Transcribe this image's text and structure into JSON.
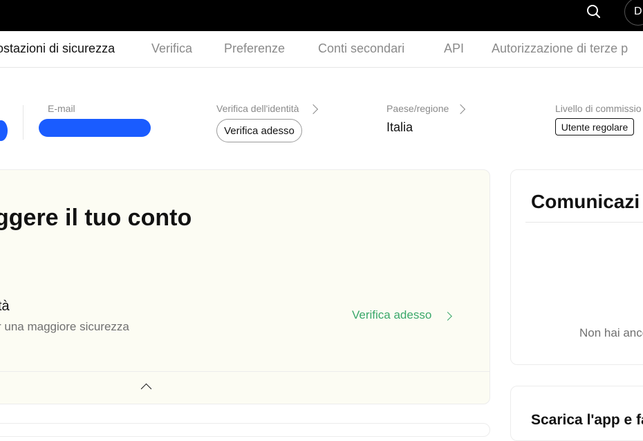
{
  "header": {
    "search_icon": "search-icon",
    "avatar_initial": "D"
  },
  "tabs": [
    {
      "label": "Impostazioni di sicurezza",
      "visible_label": "ostazioni di sicurezza",
      "active": true
    },
    {
      "label": "Verifica",
      "active": false
    },
    {
      "label": "Preferenze",
      "active": false
    },
    {
      "label": "Conti secondari",
      "active": false
    },
    {
      "label": "API",
      "active": false
    },
    {
      "label": "Autorizzazione di terze p",
      "active": false
    }
  ],
  "profile": {
    "email_label": "E-mail",
    "identity_label": "Verifica dell'identità",
    "identity_button": "Verifica adesso",
    "country_label": "Paese/regione",
    "country_value": "Italia",
    "fee_label": "Livello di commissio",
    "fee_badge": "Utente regolare"
  },
  "security_card": {
    "title": "ggere il tuo conto",
    "item_title": "tà",
    "item_subtitle": "r una maggiore sicurezza",
    "action_link": "Verifica adesso"
  },
  "announcements": {
    "title": "Comunicazi",
    "empty_text": "Non hai anco"
  },
  "app_card": {
    "title": "Scarica l'app e fa"
  },
  "colors": {
    "accent_green": "#3aa86b",
    "redaction_blue": "#1a5cff",
    "topbar": "#000000"
  }
}
